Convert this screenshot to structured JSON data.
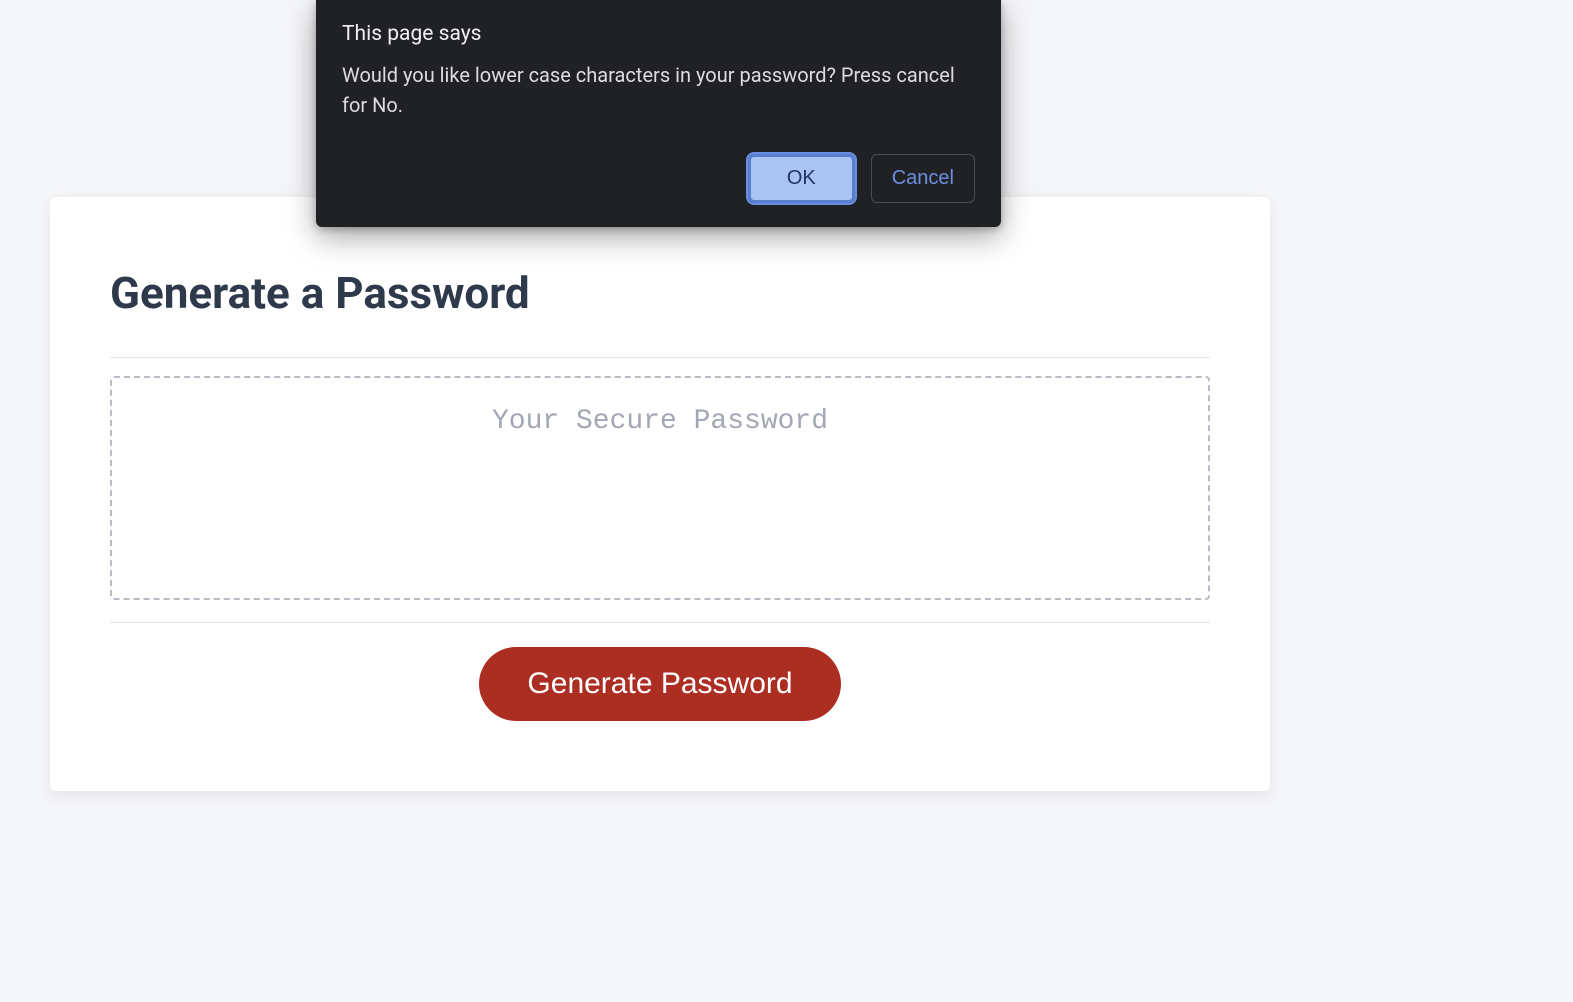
{
  "dialog": {
    "title": "This page says",
    "message": "Would you like lower case characters in your password? Press cancel for No.",
    "ok_label": "OK",
    "cancel_label": "Cancel"
  },
  "card": {
    "heading": "Generate a Password",
    "password_placeholder": "Your Secure Password",
    "password_value": "",
    "generate_label": "Generate Password"
  },
  "colors": {
    "page_bg": "#f5f6f8",
    "card_bg": "#ffffff",
    "heading_text": "#2e3a4b",
    "dashed_border": "#b8bcc4",
    "placeholder_text": "#a2a7b3",
    "primary_button_bg": "#ac2e23",
    "primary_button_text": "#ffffff",
    "dialog_bg": "#1f2125",
    "dialog_text": "#e9e9ea",
    "dialog_ok_bg": "#a9c3f3",
    "dialog_ok_border": "#5a7fd1",
    "dialog_cancel_text": "#6c90e2"
  }
}
